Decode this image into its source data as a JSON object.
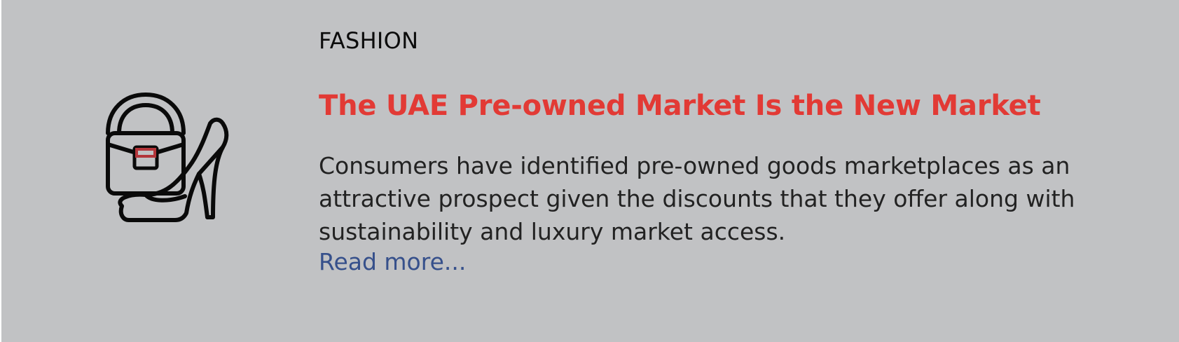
{
  "article": {
    "category": "FASHION",
    "title": "The UAE Pre-owned Market Is the New Market",
    "summary": "Consumers have identified pre-owned goods marketplaces as an attractive prospect given the discounts that they offer along with sustainability and luxury market access.",
    "read_more_label": "Read more..."
  },
  "icon": {
    "name": "handbag-and-heel-icon",
    "stroke_color": "#0a0a0a",
    "clasp_color": "#b3353a"
  },
  "colors": {
    "background": "#c1c2c4",
    "title": "#e23a35",
    "link": "#36508b",
    "text": "#222222"
  }
}
